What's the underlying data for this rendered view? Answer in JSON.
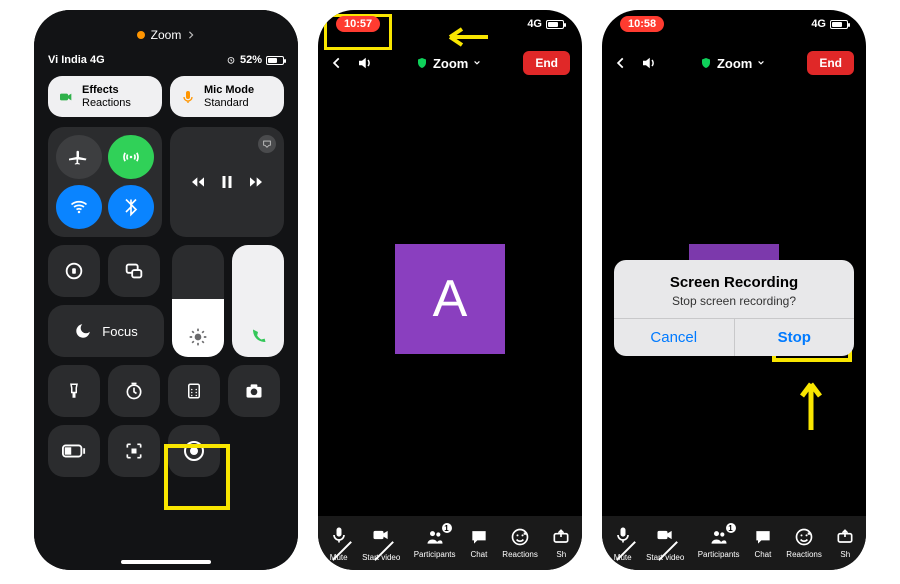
{
  "phone1": {
    "breadcrumb": "Zoom",
    "carrier": "Vi India 4G",
    "battery": "52%",
    "effects": {
      "title": "Effects",
      "sub": "Reactions"
    },
    "micmode": {
      "title": "Mic Mode",
      "sub": "Standard"
    },
    "focus_label": "Focus"
  },
  "phone2": {
    "time": "10:57",
    "network": "4G",
    "title": "Zoom",
    "end": "End",
    "avatar_letter": "A",
    "participants_badge": "1",
    "toolbar": {
      "mute": "Mute",
      "start_video": "Start video",
      "participants": "Participants",
      "chat": "Chat",
      "reactions": "Reactions",
      "share": "Sh"
    }
  },
  "phone3": {
    "time": "10:58",
    "network": "4G",
    "title": "Zoom",
    "end": "End",
    "participants_badge": "1",
    "alert": {
      "title": "Screen Recording",
      "subtitle": "Stop screen recording?",
      "cancel": "Cancel",
      "stop": "Stop"
    },
    "toolbar": {
      "mute": "Mute",
      "start_video": "Start video",
      "participants": "Participants",
      "chat": "Chat",
      "reactions": "Reactions",
      "share": "Sh"
    }
  }
}
